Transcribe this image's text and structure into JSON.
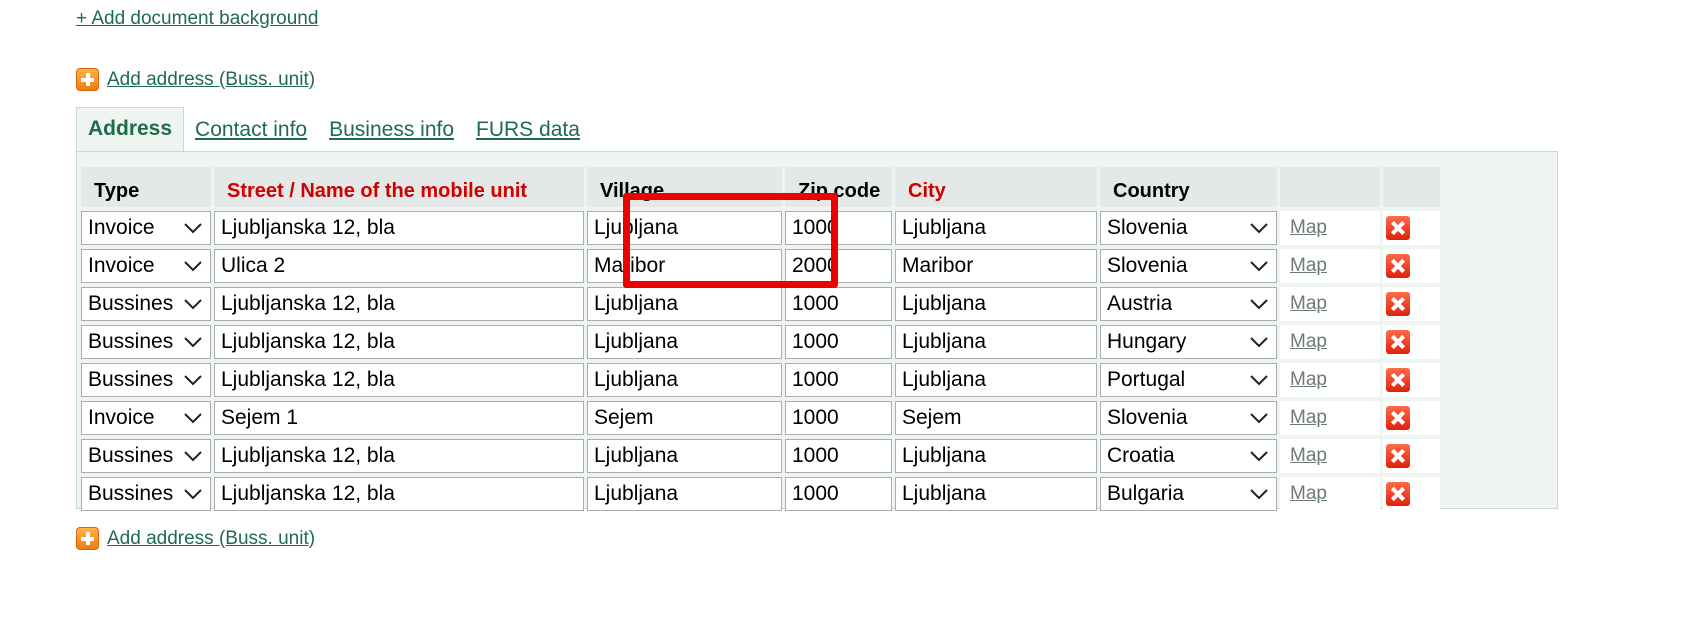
{
  "top_link": "+ Add document background",
  "add_address_label": "Add address (Buss. unit)",
  "tabs": [
    {
      "label": "Address",
      "active": true
    },
    {
      "label": "Contact info",
      "active": false
    },
    {
      "label": "Business info",
      "active": false
    },
    {
      "label": "FURS data",
      "active": false
    }
  ],
  "columns": {
    "type": "Type",
    "street": "Street / Name of the mobile unit",
    "village": "Village",
    "zip": "Zip code",
    "city": "City",
    "country": "Country"
  },
  "rows": [
    {
      "type": "Invoice",
      "street": "Ljubljanska 12, bla",
      "village": "Ljubljana",
      "zip": "1000",
      "city": "Ljubljana",
      "country": "Slovenia",
      "map": "Map"
    },
    {
      "type": "Invoice",
      "street": "Ulica 2",
      "village": "Maribor",
      "zip": "2000",
      "city": "Maribor",
      "country": "Slovenia",
      "map": "Map"
    },
    {
      "type": "Bussines",
      "street": "Ljubljanska 12, bla",
      "village": "Ljubljana",
      "zip": "1000",
      "city": "Ljubljana",
      "country": "Austria",
      "map": "Map"
    },
    {
      "type": "Bussines",
      "street": "Ljubljanska 12, bla",
      "village": "Ljubljana",
      "zip": "1000",
      "city": "Ljubljana",
      "country": "Hungary",
      "map": "Map"
    },
    {
      "type": "Bussines",
      "street": "Ljubljanska 12, bla",
      "village": "Ljubljana",
      "zip": "1000",
      "city": "Ljubljana",
      "country": "Portugal",
      "map": "Map"
    },
    {
      "type": "Invoice",
      "street": "Sejem 1",
      "village": "Sejem",
      "zip": "1000",
      "city": "Sejem",
      "country": "Slovenia",
      "map": "Map"
    },
    {
      "type": "Bussines",
      "street": "Ljubljanska 12, bla",
      "village": "Ljubljana",
      "zip": "1000",
      "city": "Ljubljana",
      "country": "Croatia",
      "map": "Map"
    },
    {
      "type": "Bussines",
      "street": "Ljubljanska 12, bla",
      "village": "Ljubljana",
      "zip": "1000",
      "city": "Ljubljana",
      "country": "Bulgaria",
      "map": "Map"
    }
  ],
  "colors": {
    "link": "#1f6b4d",
    "required": "#d00000",
    "highlight": "#ee0000",
    "panel_bg": "#eef4ef"
  },
  "icons": {
    "add": "plus-icon",
    "delete": "delete-icon",
    "dropdown": "chevron-down-icon"
  }
}
